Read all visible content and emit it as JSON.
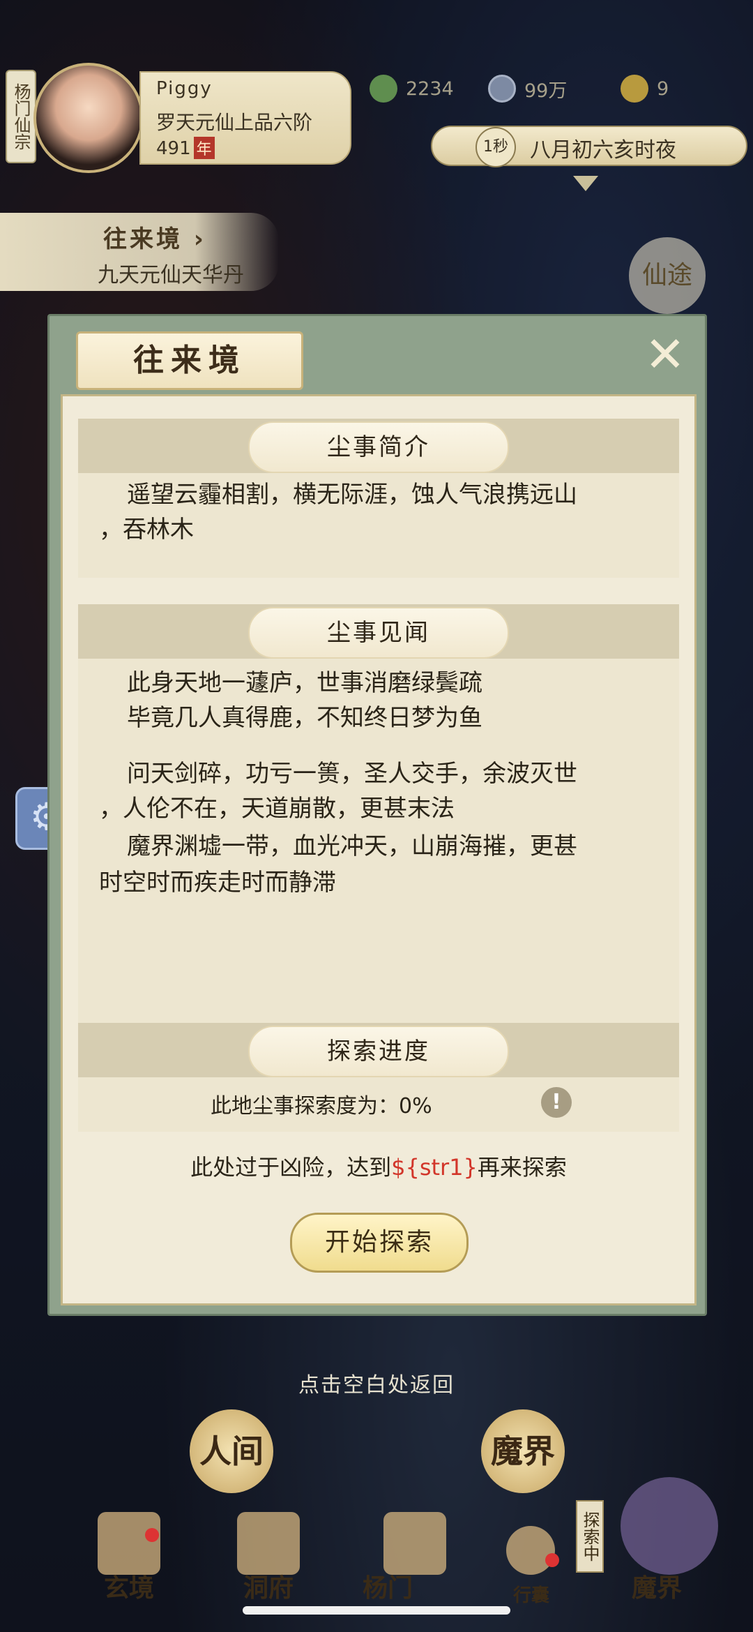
{
  "header": {
    "sect": "杨门仙宗",
    "player_name": "Piggy",
    "rank": "罗天元仙上品六阶",
    "years": "491",
    "year_unit": "年",
    "res_jade": "2234",
    "res_coin": "99万",
    "res_gold": "9",
    "time_step": "1秒",
    "date_text": "八月初六亥时夜"
  },
  "sidebar": {
    "realm_title": "往来境 ›",
    "realm_item": "九天元仙天华丹",
    "new_badge": "仙途"
  },
  "modal": {
    "title": "往来境",
    "intro_title": "尘事简介",
    "intro_text_1": "遥望云霾相割，横无际涯，蚀人气浪携远山",
    "intro_text_2": "，吞林木",
    "news_title": "尘事见闻",
    "news_lines": [
      "此身天地一蘧庐，世事消磨绿鬓疏",
      "毕竟几人真得鹿，不知终日梦为鱼",
      "问天剑碎，功亏一篑，圣人交手，余波灭世",
      "，人伦不在，天道崩散，更甚末法",
      "魔界渊墟一带，血光冲天，山崩海摧，更甚",
      "时空时而疾走时而静滞"
    ],
    "progress_title": "探索进度",
    "progress_text": "此地尘事探索度为：0%",
    "danger_prefix": "此处过于凶险，达到",
    "danger_var": "${str1}",
    "danger_suffix": "再来探索",
    "start_button": "开始探索"
  },
  "bottom": {
    "back_tip": "点击空白处返回",
    "world_human": "人间",
    "world_demon": "魔界",
    "explore_tag": "探索中",
    "nav": [
      "玄境",
      "洞府",
      "杨门",
      "行囊",
      "魔界"
    ]
  }
}
